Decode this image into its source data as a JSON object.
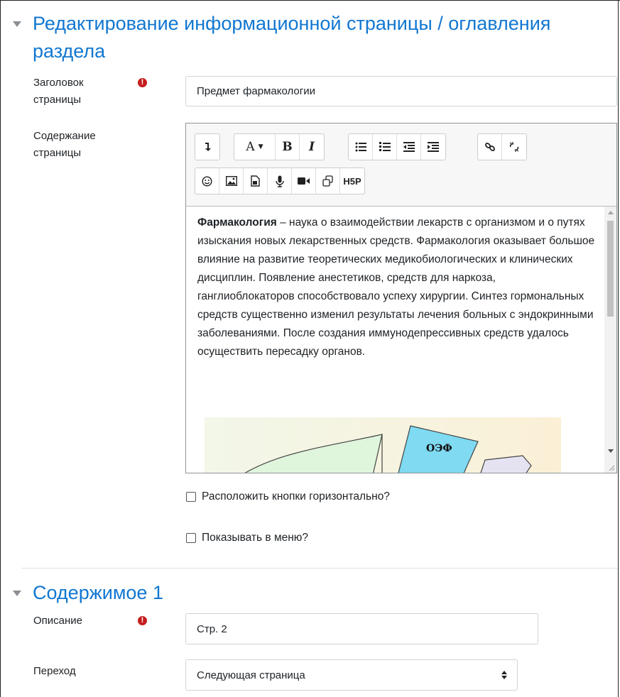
{
  "section1": {
    "title": "Редактирование информационной страницы / оглавления раздела"
  },
  "fields": {
    "page_title": {
      "label": "Заголовок страницы",
      "value": "Предмет фармакологии"
    },
    "page_content": {
      "label": "Содержание страницы"
    }
  },
  "toolbar": {
    "row1": [
      "collapse-icon",
      "font-color-icon",
      "bold-icon",
      "italic-icon",
      "unordered-list-icon",
      "ordered-list-icon",
      "outdent-icon",
      "indent-icon",
      "link-icon",
      "unlink-icon"
    ],
    "row2": [
      "emoticon-icon",
      "image-icon",
      "media-icon",
      "record-audio-icon",
      "record-video-icon",
      "manage-files-icon",
      "h5p-icon"
    ],
    "labels": {
      "font": "A",
      "bold": "B",
      "italic": "I",
      "h5p": "H5P"
    }
  },
  "editor": {
    "bold_lead": "Фармакология",
    "text": " – наука о взаимодействии лекарств с организмом и о путях изыскания новых лекарственных средств. Фармакология оказывает большое влияние на развитие теоретических медикобиологических и клинических дисциплин. Появление анестетиков, средств для наркоза, ганглиоблокаторов способствовало успеху хирургии. Синтез гормональных средств существенно изменил результаты лечения больных с эндокринными заболеваниями. После создания иммунодепрессивных средств удалось осуществить пересадку органов.",
    "image_label": "ОЭФ"
  },
  "checkboxes": {
    "horizontal": {
      "label": "Расположить кнопки горизонтально?",
      "checked": false
    },
    "show_menu": {
      "label": "Показывать в меню?",
      "checked": false
    }
  },
  "section2": {
    "title": "Содержимое 1"
  },
  "content1": {
    "description": {
      "label": "Описание",
      "value": "Стр. 2"
    },
    "jump": {
      "label": "Переход",
      "value": "Следующая страница"
    }
  },
  "colors": {
    "accent": "#1177d1",
    "required": "#c41d1d"
  }
}
